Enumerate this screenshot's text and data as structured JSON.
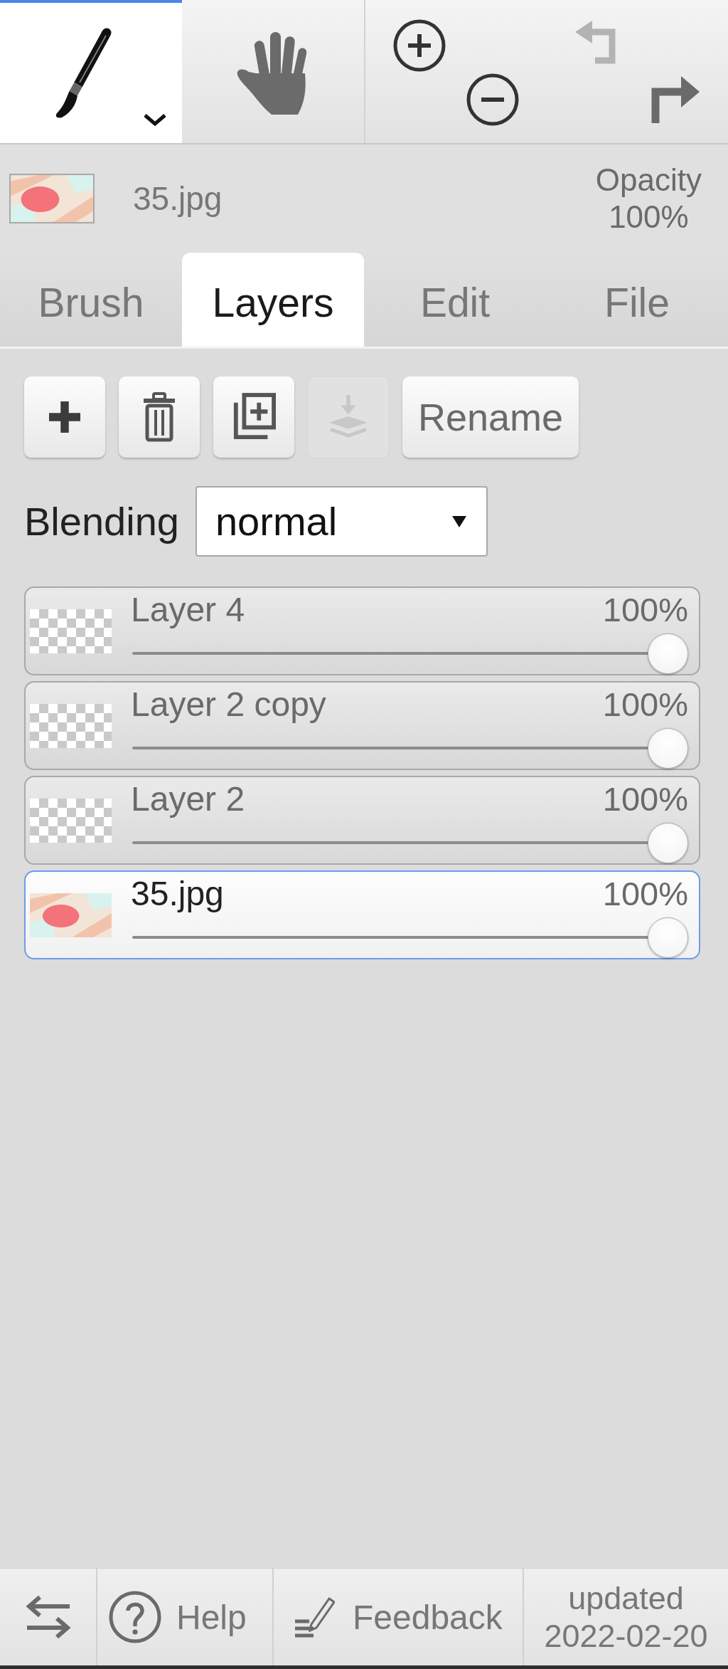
{
  "toolbar": {
    "tools": [
      {
        "kind": "brush",
        "selected": true,
        "menu": true
      },
      {
        "kind": "hand",
        "selected": false,
        "menu": false
      }
    ],
    "zoom": [
      {
        "kind": "zoom_in"
      },
      {
        "kind": "zoom_out"
      }
    ],
    "history": [
      {
        "kind": "undo",
        "disabled": true
      },
      {
        "kind": "redo",
        "disabled": false
      }
    ]
  },
  "current_layer": {
    "kind": "image",
    "name": "35.jpg",
    "opacity_label": "Opacity",
    "opacity": "100%"
  },
  "tabs": [
    {
      "label": "Brush",
      "selected": false
    },
    {
      "label": "Layers",
      "selected": true
    },
    {
      "label": "Edit",
      "selected": false
    },
    {
      "label": "File",
      "selected": false
    }
  ],
  "layer_actions": [
    {
      "kind": "add",
      "disabled": false
    },
    {
      "kind": "delete",
      "disabled": false
    },
    {
      "kind": "duplicate",
      "disabled": false
    },
    {
      "kind": "merge_down",
      "disabled": true
    },
    {
      "kind": "text",
      "label": "Rename",
      "disabled": false
    }
  ],
  "blending": {
    "label": "Blending",
    "value": "normal"
  },
  "layers": [
    {
      "kind": "checker",
      "name": "Layer 4",
      "opacity": "100%",
      "level": 1,
      "selected": false
    },
    {
      "kind": "checker",
      "name": "Layer 2 copy",
      "opacity": "100%",
      "level": 1,
      "selected": false
    },
    {
      "kind": "checker",
      "name": "Layer 2",
      "opacity": "100%",
      "level": 1,
      "selected": false
    },
    {
      "kind": "image",
      "name": "35.jpg",
      "opacity": "100%",
      "level": 1,
      "selected": true
    }
  ],
  "footer": {
    "items": [
      {
        "kind": "swap"
      },
      {
        "kind": "help",
        "label": "Help"
      },
      {
        "kind": "feedback",
        "label": "Feedback"
      }
    ],
    "updated": {
      "label": "updated",
      "date": "2022-02-20"
    }
  }
}
